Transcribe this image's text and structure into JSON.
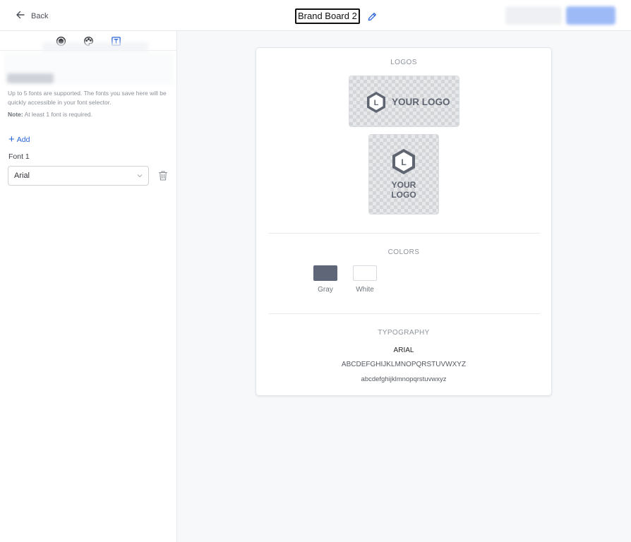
{
  "header": {
    "back_label": "Back",
    "board_title": "Brand Board 2"
  },
  "sidebar": {
    "tabs": [
      {
        "icon": "cube-icon"
      },
      {
        "icon": "palette-icon"
      },
      {
        "icon": "text-icon",
        "active": true
      }
    ],
    "description": "Up to 5 fonts are supported. The fonts you save here will be quickly accessible in your font selector.",
    "note_label": "Note:",
    "note_text": "At least 1 font is required.",
    "add_label": "Add",
    "font_label": "Font 1",
    "font_value": "Arial"
  },
  "board": {
    "logos_title": "LOGOS",
    "logo_text_horizontal": "YOUR LOGO",
    "logo_text_line1": "YOUR",
    "logo_text_line2": "LOGO",
    "logo_letter": "L",
    "colors_title": "COLORS",
    "colors": [
      {
        "name": "Gray",
        "hex": "#5f6678"
      },
      {
        "name": "White",
        "hex": "#ffffff"
      }
    ],
    "typography_title": "TYPOGRAPHY",
    "font_name": "ARIAL",
    "uppercase_sample": "ABCDEFGHIJKLMNOPQRSTUVWXYZ",
    "lowercase_sample": "abcdefghijklmnopqrstuvwxyz"
  },
  "theme": {
    "accent": "#2a64d8"
  }
}
